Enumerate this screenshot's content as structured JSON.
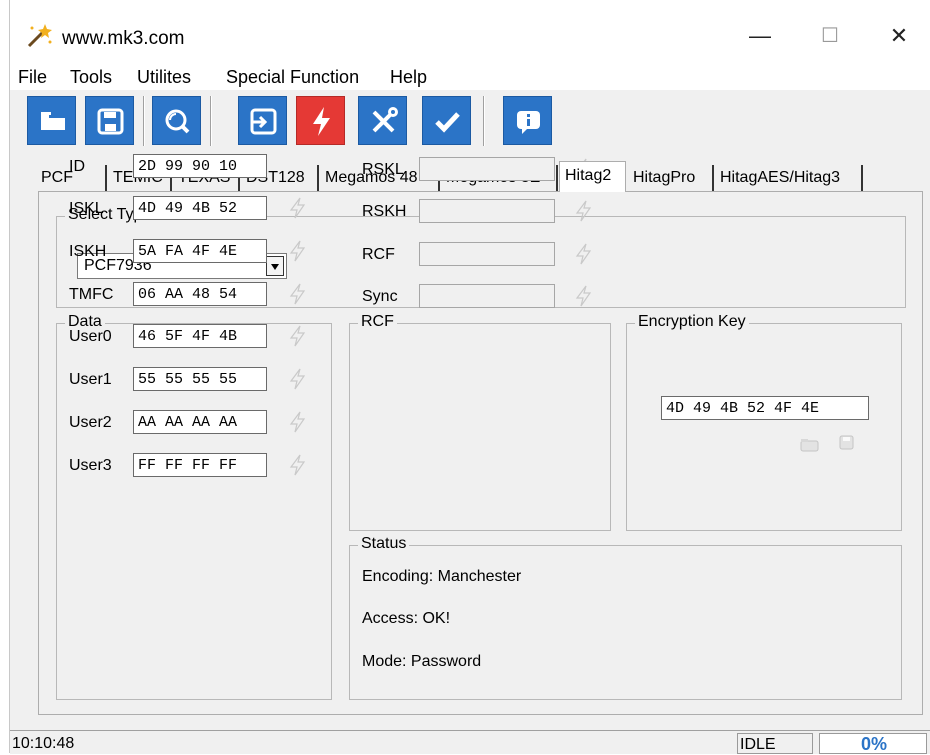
{
  "window": {
    "title": "www.mk3.com",
    "min_symbol": "—",
    "max_symbol": "☐",
    "close_symbol": "✕"
  },
  "menu": [
    "File",
    "Tools",
    "Utilites",
    "Special Function",
    "Help"
  ],
  "toolbar": [
    {
      "icon": "folder-icon"
    },
    {
      "icon": "save-icon"
    },
    {
      "icon": "search-icon"
    },
    {
      "icon": "read-icon"
    },
    {
      "icon": "bolt-icon",
      "color": "#e53935"
    },
    {
      "icon": "tools-icon"
    },
    {
      "icon": "check-icon"
    },
    {
      "icon": "info-icon"
    }
  ],
  "tabs": [
    "PCF",
    "TEMIC",
    "TEXAS",
    "DST128",
    "Megamos 48",
    "Megamos 8E",
    "Hitag2",
    "HitagPro",
    "HitagAES/Hitag3"
  ],
  "active_tab": "Hitag2",
  "select_type": {
    "title": "Select Type TP",
    "value": "PCF7936"
  },
  "data_group": {
    "title": "Data",
    "rows": [
      {
        "label": "ID",
        "value": "2D 99 90 10"
      },
      {
        "label": "ISKL",
        "value": "4D 49 4B 52"
      },
      {
        "label": "ISKH",
        "value": "5A FA 4F 4E"
      },
      {
        "label": "TMFC",
        "value": "06 AA 48 54"
      },
      {
        "label": "User0",
        "value": "46 5F 4F 4B"
      },
      {
        "label": "User1",
        "value": "55 55 55 55"
      },
      {
        "label": "User2",
        "value": "AA AA AA AA"
      },
      {
        "label": "User3",
        "value": "FF FF FF FF"
      }
    ]
  },
  "rcf_group": {
    "title": "RCF",
    "rows": [
      {
        "label": "RSKL",
        "value": ""
      },
      {
        "label": "RSKH",
        "value": ""
      },
      {
        "label": "RCF",
        "value": ""
      },
      {
        "label": "Sync",
        "value": ""
      }
    ]
  },
  "encryption_group": {
    "title": "Encryption Key",
    "value": "4D 49 4B 52 4F 4E"
  },
  "status_group": {
    "title": "Status",
    "lines": [
      "Encoding: Manchester",
      "Access: OK!",
      "Mode: Password"
    ]
  },
  "statusbar": {
    "time": "10:10:48",
    "state": "IDLE",
    "progress": "0%"
  },
  "colors": {
    "toolbar_blue": "#2b74c7",
    "toolbar_red": "#e53935",
    "progress_text": "#2b74c7"
  }
}
